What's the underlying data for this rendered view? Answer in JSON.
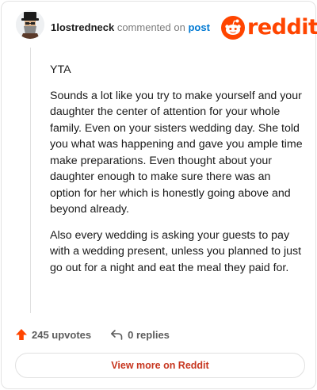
{
  "header": {
    "username": "1lostredneck",
    "action_text": "commented on",
    "target_link": "post",
    "logo_text": "reddit"
  },
  "comment": {
    "paragraphs": [
      "YTA",
      "Sounds a lot like you try to make yourself and your daughter the center of attention for your whole family. Even on your sisters wedding day. She told you what was happening and gave you ample time make preparations. Even thought about your daughter enough to make sure there was an option for her which is honestly going above and beyond already.",
      "Also every wedding is asking your guests to pay with a wedding present, unless you planned to just go out for a night and eat the meal they paid for."
    ]
  },
  "footer": {
    "upvotes_label": "245 upvotes",
    "replies_label": "0 replies",
    "view_more_label": "View more on Reddit"
  },
  "colors": {
    "brand": "#ff4500",
    "link": "#0079d3",
    "view_more": "#c7361f"
  },
  "icons": {
    "upvote": "upvote-arrow-icon",
    "reply": "reply-arrow-icon",
    "logo": "reddit-snoo-icon",
    "avatar": "user-avatar"
  }
}
